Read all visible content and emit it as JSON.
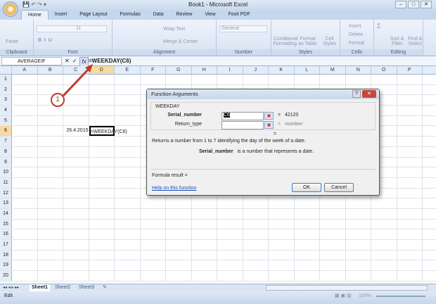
{
  "window": {
    "title": "Book1 - Microsoft Excel"
  },
  "tabs": [
    "Home",
    "Insert",
    "Page Layout",
    "Formulas",
    "Data",
    "Review",
    "View",
    "Foxit PDF"
  ],
  "ribbon": {
    "clipboard": {
      "label": "Clipboard",
      "paste": "Paste"
    },
    "font": {
      "label": "Font",
      "size": "11"
    },
    "alignment": {
      "label": "Alignment",
      "wrap": "Wrap Text",
      "merge": "Merge & Center"
    },
    "number": {
      "label": "Number",
      "format": "General"
    },
    "styles": {
      "label": "Styles",
      "items": [
        "Conditional Formatting",
        "Format as Table",
        "Cell Styles"
      ]
    },
    "cells": {
      "label": "Cells",
      "items": [
        "Insert",
        "Delete",
        "Format"
      ]
    },
    "editing": {
      "label": "Editing",
      "items": [
        "Sort & Filter",
        "Find & Select"
      ]
    }
  },
  "formula_bar": {
    "name_box": "AVERAGEIF",
    "formula": "=WEEKDAY(C6)",
    "cancel": "✕",
    "enter": "✓",
    "fx": "fx"
  },
  "columns": [
    "A",
    "B",
    "C",
    "D",
    "E",
    "F",
    "G",
    "H",
    "I",
    "J",
    "K",
    "L",
    "M",
    "N",
    "O",
    "P"
  ],
  "rows": [
    1,
    2,
    3,
    4,
    5,
    6,
    7,
    8,
    9,
    10,
    11,
    12,
    13,
    14,
    15,
    16,
    17,
    18,
    19,
    20
  ],
  "cells": {
    "C6": "26.4.2015",
    "D6": "=WEEKDAY(C6)"
  },
  "callout": "1",
  "dialog": {
    "title": "Function Arguments",
    "function": "WEEKDAY",
    "args": [
      {
        "label": "Serial_number",
        "value": "C6",
        "result": "42120"
      },
      {
        "label": "Return_type",
        "value": "",
        "result": "number"
      }
    ],
    "eq": "=",
    "description": "Returns a number from 1 to 7 identifying the day of the week of a date.",
    "arg_help_name": "Serial_number",
    "arg_help": "is a number that represents a date.",
    "formula_result": "Formula result =",
    "help_link": "Help on this function",
    "ok": "OK",
    "cancel": "Cancel"
  },
  "sheets": [
    "Sheet1",
    "Sheet2",
    "Sheet3"
  ],
  "status": {
    "mode": "Edit",
    "zoom": "100%"
  }
}
